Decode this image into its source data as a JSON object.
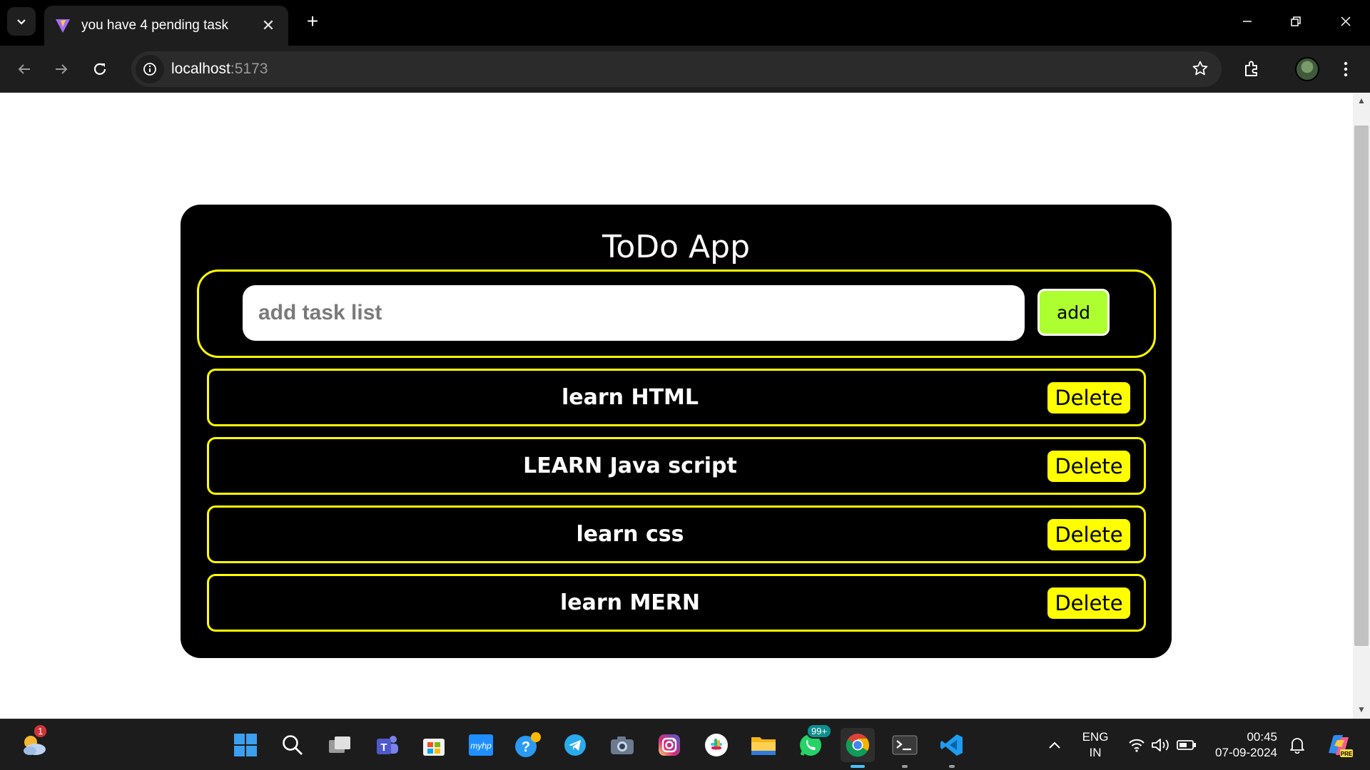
{
  "browser": {
    "tab_title": "you have 4 pending task",
    "url_host": "localhost",
    "url_port": ":5173"
  },
  "app": {
    "title": "ToDo App",
    "input_placeholder": "add task list",
    "input_value": "",
    "add_label": "add",
    "delete_label": "Delete",
    "tasks": [
      {
        "text": "learn HTML"
      },
      {
        "text": "LEARN Java script"
      },
      {
        "text": "learn css"
      },
      {
        "text": "learn MERN"
      }
    ],
    "colors": {
      "card_bg": "#000000",
      "border_accent": "#ffff00",
      "add_button": "#adff2f",
      "delete_button": "#ffff00"
    }
  },
  "taskbar": {
    "weather_badge": "1",
    "whatsapp_badge": "99+",
    "language_top": "ENG",
    "language_bottom": "IN",
    "time": "00:45",
    "date": "07-09-2024",
    "copilot_badge": "PRE",
    "pinned_apps": [
      "start-icon",
      "search-icon",
      "task-view-icon",
      "teams-icon",
      "store-icon",
      "myhp-icon",
      "help-icon",
      "telegram-icon",
      "camera-icon",
      "instagram-icon",
      "slack-icon",
      "file-explorer-icon",
      "whatsapp-icon",
      "chrome-icon",
      "terminal-icon",
      "vscode-icon"
    ]
  }
}
